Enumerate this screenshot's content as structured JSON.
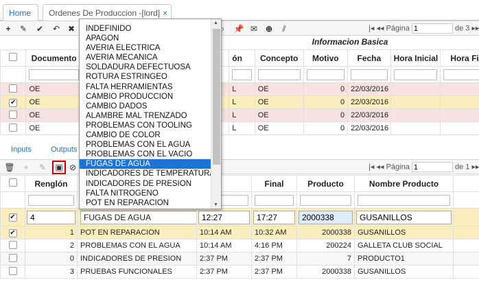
{
  "tabs": {
    "home": "Home",
    "active": "Ordenes De Produccion -[lord]",
    "close": "×"
  },
  "top_grid": {
    "group_header": "Informacion Basica",
    "columns": [
      "Documento",
      "ón",
      "Concepto",
      "Motivo",
      "Fecha",
      "Hora Inicial",
      "Hora Final"
    ],
    "rows": [
      {
        "checked": false,
        "doc": "OE",
        "conc": "L",
        "concepto": "OE",
        "motivo": "0",
        "fecha": "22/03/2016"
      },
      {
        "checked": true,
        "doc": "OE",
        "conc": "L",
        "concepto": "OE",
        "motivo": "0",
        "fecha": "22/03/2016"
      },
      {
        "checked": false,
        "doc": "OE",
        "conc": "L",
        "concepto": "OE",
        "motivo": "0",
        "fecha": "22/03/2016"
      },
      {
        "checked": false,
        "doc": "OE",
        "conc": "L",
        "concepto": "OE",
        "motivo": "0",
        "fecha": "22/03/2016"
      }
    ],
    "pager": {
      "label": "Página",
      "value": "1",
      "of": "de 3"
    }
  },
  "links": {
    "inputs": "Inputs",
    "outputs": "Outputs"
  },
  "bottom_grid": {
    "columns": [
      "Renglón",
      "icial",
      "Final",
      "Producto",
      "Nombre Producto"
    ],
    "pager": {
      "label": "Página",
      "value": "1",
      "of": "de 1"
    },
    "edit_row": {
      "renglon": "4",
      "motivo": "FUGAS DE AGUA",
      "inicial": "12:27",
      "final": "17:27",
      "producto": "2000338",
      "nombre": "GUSANILLOS"
    },
    "rows": [
      {
        "checked": true,
        "renglon": "1",
        "motivo": "POT EN REPARACION",
        "inicial": "10:14 AM",
        "final": "10:32 AM",
        "producto": "2000338",
        "nombre": "GUSANILLOS"
      },
      {
        "checked": false,
        "renglon": "2",
        "motivo": "PROBLEMAS CON EL AGUA",
        "inicial": "10:14 AM",
        "final": "4:16 PM",
        "producto": "200224",
        "nombre": "GALLETA CLUB SOCIAL"
      },
      {
        "checked": false,
        "renglon": "0",
        "motivo": "INDICADORES DE PRESION",
        "inicial": "2:37 PM",
        "final": "2:37 PM",
        "producto": "7",
        "nombre": "PRODUCTO1"
      },
      {
        "checked": false,
        "renglon": "3",
        "motivo": "PRUEBAS FUNCIONALES",
        "inicial": "2:37 PM",
        "final": "2:37 PM",
        "producto": "2000338",
        "nombre": "GUSANILLOS"
      }
    ]
  },
  "dropdown": {
    "selected": "FUGAS DE AGUA",
    "options": [
      "INDEFINIDO",
      "APAGON",
      "AVERIA ELECTRICA",
      "AVERIA MECANICA",
      "SOLDADURA DEFECTUOSA",
      "ROTURA ESTRINGEO",
      "FALTA HERRAMIENTAS",
      "CAMBIO PRODUCCION",
      "CAMBIO DADOS",
      "ALAMBRE MAL TRENZADO",
      "PROBLEMAS CON TOOLING",
      "CAMBIO DE COLOR",
      "PROBLEMAS CON EL AGUA",
      "PROBLEMAS CON EL VACIO",
      "FUGAS DE AGUA",
      "INDICADORES DE TEMPERATURA",
      "INDICADORES DE PRESION",
      "FALTA NITROGENO",
      "POT EN REPARACION"
    ]
  }
}
